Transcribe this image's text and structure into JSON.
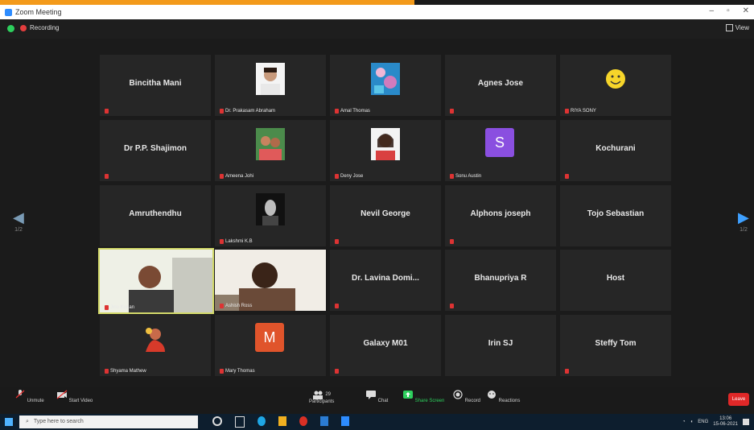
{
  "window": {
    "title": "Zoom Meeting"
  },
  "topbar": {
    "recording_label": "Recording",
    "view_label": "View"
  },
  "nav": {
    "left_page": "1/2",
    "right_page": "1/2"
  },
  "tiles": [
    {
      "name": "Bincitha Mani",
      "label": ""
    },
    {
      "name": "",
      "label": "Dr. Prakasam Abraham"
    },
    {
      "name": "",
      "label": "Amal Thomas"
    },
    {
      "name": "Agnes Jose",
      "label": ""
    },
    {
      "name": "",
      "label": "RIYA SONY"
    },
    {
      "name": "Dr P.P. Shajimon",
      "label": ""
    },
    {
      "name": "",
      "label": "Ameena Johi"
    },
    {
      "name": "",
      "label": "Deny Jose"
    },
    {
      "name": "",
      "label": "Sonu Austin"
    },
    {
      "name": "Kochurani",
      "label": ""
    },
    {
      "name": "Amruthendhu",
      "label": ""
    },
    {
      "name": "",
      "label": "Lakshmi K.B"
    },
    {
      "name": "Nevil George",
      "label": ""
    },
    {
      "name": "Alphons joseph",
      "label": ""
    },
    {
      "name": "Tojo Sebastian",
      "label": ""
    },
    {
      "name": "",
      "label": "Jino Kurian"
    },
    {
      "name": "",
      "label": "Ashish Ross"
    },
    {
      "name": "Dr. Lavina Domi...",
      "label": ""
    },
    {
      "name": "Bhanupriya R",
      "label": ""
    },
    {
      "name": "Host",
      "label": ""
    },
    {
      "name": "",
      "label": "Shyama Mathew"
    },
    {
      "name": "",
      "label": "Mary Thomas"
    },
    {
      "name": "Galaxy M01",
      "label": ""
    },
    {
      "name": "Irin SJ",
      "label": ""
    },
    {
      "name": "Steffy Tom",
      "label": ""
    }
  ],
  "avatars": {
    "sonu_letter": "S",
    "mary_letter": "M"
  },
  "toolbar": {
    "unmute": "Unmute",
    "start_video": "Start Video",
    "participants": "Participants",
    "participants_count": "29",
    "chat": "Chat",
    "share": "Share Screen",
    "record": "Record",
    "reactions": "Reactions",
    "end": "Leave"
  },
  "taskbar": {
    "search_placeholder": "Type here to search",
    "time": "13:06",
    "date": "15-06-2021",
    "lang": "ENG"
  }
}
